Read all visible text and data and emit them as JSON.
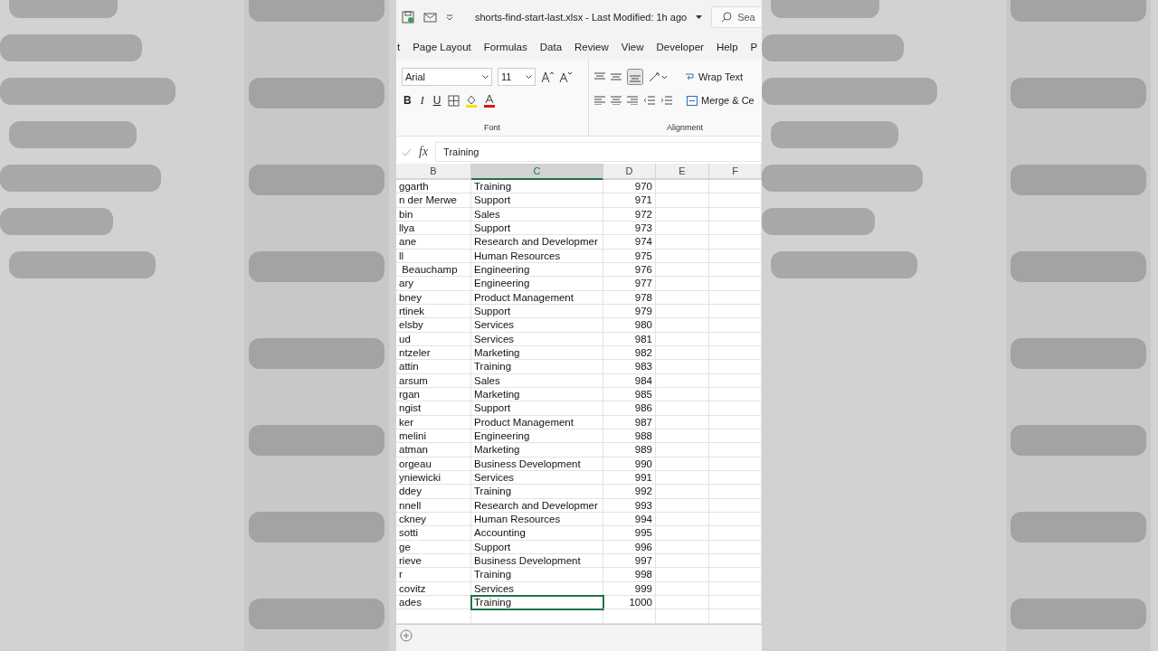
{
  "title_bar": {
    "title": "shorts-find-start-last.xlsx  -  Last Modified: 1h ago",
    "search": "Sea"
  },
  "tabs": [
    "t",
    "Page Layout",
    "Formulas",
    "Data",
    "Review",
    "View",
    "Developer",
    "Help",
    "P"
  ],
  "ribbon": {
    "font_name": "Arial",
    "font_size": "11",
    "bold": "B",
    "italic": "I",
    "underline": "U",
    "font_group": "Font",
    "alignment_group": "Alignment",
    "wrap_text": "Wrap Text",
    "merge": "Merge & Ce"
  },
  "formula_bar": {
    "fx": "fx",
    "value": "Training"
  },
  "columns": [
    {
      "label": "B",
      "selected": false
    },
    {
      "label": "C",
      "selected": true
    },
    {
      "label": "D",
      "selected": false
    },
    {
      "label": "E",
      "selected": false
    },
    {
      "label": "F",
      "selected": false
    }
  ],
  "rows": [
    {
      "name": "ggarth",
      "dept": "Training",
      "id": "970",
      "selected": false
    },
    {
      "name": "n der Merwe",
      "dept": "Support",
      "id": "971",
      "selected": false
    },
    {
      "name": "bin",
      "dept": "Sales",
      "id": "972",
      "selected": false
    },
    {
      "name": "llya",
      "dept": "Support",
      "id": "973",
      "selected": false
    },
    {
      "name": "ane",
      "dept": "Research and Developmer",
      "id": "974",
      "selected": false
    },
    {
      "name": "ll",
      "dept": "Human Resources",
      "id": "975",
      "selected": false
    },
    {
      "name": " Beauchamp",
      "dept": "Engineering",
      "id": "976",
      "selected": false
    },
    {
      "name": "ary",
      "dept": "Engineering",
      "id": "977",
      "selected": false
    },
    {
      "name": "bney",
      "dept": "Product Management",
      "id": "978",
      "selected": false
    },
    {
      "name": "rtinek",
      "dept": "Support",
      "id": "979",
      "selected": false
    },
    {
      "name": "elsby",
      "dept": "Services",
      "id": "980",
      "selected": false
    },
    {
      "name": "ud",
      "dept": "Services",
      "id": "981",
      "selected": false
    },
    {
      "name": "ntzeler",
      "dept": "Marketing",
      "id": "982",
      "selected": false
    },
    {
      "name": "attin",
      "dept": "Training",
      "id": "983",
      "selected": false
    },
    {
      "name": "arsum",
      "dept": "Sales",
      "id": "984",
      "selected": false
    },
    {
      "name": "rgan",
      "dept": "Marketing",
      "id": "985",
      "selected": false
    },
    {
      "name": "ngist",
      "dept": "Support",
      "id": "986",
      "selected": false
    },
    {
      "name": "ker",
      "dept": "Product Management",
      "id": "987",
      "selected": false
    },
    {
      "name": "melini",
      "dept": "Engineering",
      "id": "988",
      "selected": false
    },
    {
      "name": "atman",
      "dept": "Marketing",
      "id": "989",
      "selected": false
    },
    {
      "name": "orgeau",
      "dept": "Business Development",
      "id": "990",
      "selected": false
    },
    {
      "name": "yniewicki",
      "dept": "Services",
      "id": "991",
      "selected": false
    },
    {
      "name": "ddey",
      "dept": "Training",
      "id": "992",
      "selected": false
    },
    {
      "name": "nnell",
      "dept": "Research and Developmer",
      "id": "993",
      "selected": false
    },
    {
      "name": "ckney",
      "dept": "Human Resources",
      "id": "994",
      "selected": false
    },
    {
      "name": "sotti",
      "dept": "Accounting",
      "id": "995",
      "selected": false
    },
    {
      "name": "ge",
      "dept": "Support",
      "id": "996",
      "selected": false
    },
    {
      "name": "rieve",
      "dept": "Business Development",
      "id": "997",
      "selected": false
    },
    {
      "name": "r",
      "dept": "Training",
      "id": "998",
      "selected": false
    },
    {
      "name": "covitz",
      "dept": "Services",
      "id": "999",
      "selected": false
    },
    {
      "name": "ades",
      "dept": "Training",
      "id": "1000",
      "selected": true
    }
  ]
}
